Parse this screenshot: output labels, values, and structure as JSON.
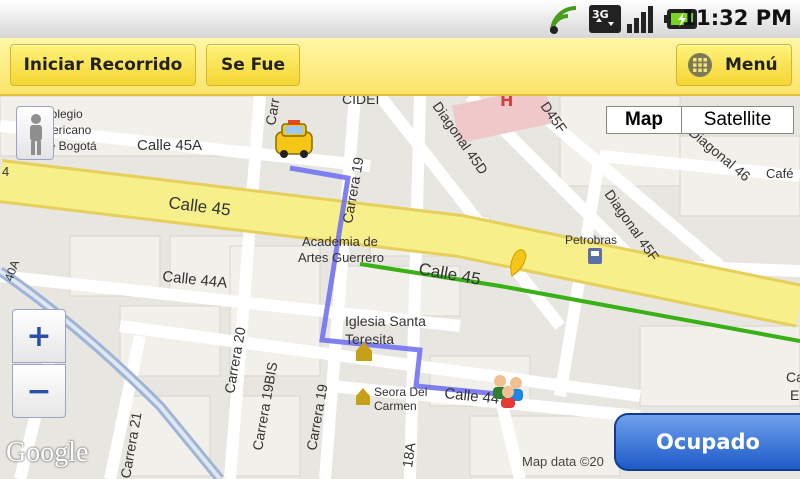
{
  "status_bar": {
    "time": "11:32 PM",
    "icons": [
      "signal-wifi-icon",
      "3g-data-icon",
      "cell-signal-icon",
      "battery-charging-icon"
    ]
  },
  "action_bar": {
    "start_trip_label": "Iniciar Recorrido",
    "se_fue_label": "Se Fue",
    "menu_label": "Menú"
  },
  "map": {
    "map_type": {
      "map_label": "Map",
      "satellite_label": "Satellite",
      "selected": "Map"
    },
    "zoom_in_label": "+",
    "zoom_out_label": "−",
    "google_label": "Google",
    "attribution": "Map data ©20",
    "labels": {
      "colegio": [
        "Colegio",
        "mericano",
        "de Bogotá"
      ],
      "calle45a": "Calle 45A",
      "cidei": "CIDEI",
      "diagonal45d": "Diagonal 45D",
      "d45f": "D45F",
      "diagonal46": "Diagonal 46",
      "cafe": "Café",
      "carrera19": "Carrera 19",
      "carr": "Carr",
      "calle45": "Calle 45",
      "calle45_right": "Calle 45",
      "academia": [
        "Academia de",
        "Artes Guerrero"
      ],
      "petrobras": "Petrobras",
      "diagonal45f": "Diagonal 45F",
      "calle44a": "Calle 44A",
      "iglesia": [
        "Iglesia Santa",
        "Teresita"
      ],
      "carrera20": "Carrera 20",
      "carrera19bis": "Carrera 19BIS",
      "carrera19b": "Carrera 19",
      "carrera21": "Carrera 21",
      "seora": [
        "Seora Del",
        "Carmen"
      ],
      "calle44": "Calle 44",
      "k18a": "18A",
      "ca": [
        "Ca",
        "E"
      ],
      "k40a": "40A",
      "c4": "4"
    }
  },
  "ocupado_label": "Ocupado",
  "colors": {
    "action_bar": "#fbe46a",
    "route": "#6b6bf2",
    "highway": "#f7ef8a",
    "green_line": "#39b016",
    "ocupado": "#1d5bc6"
  }
}
